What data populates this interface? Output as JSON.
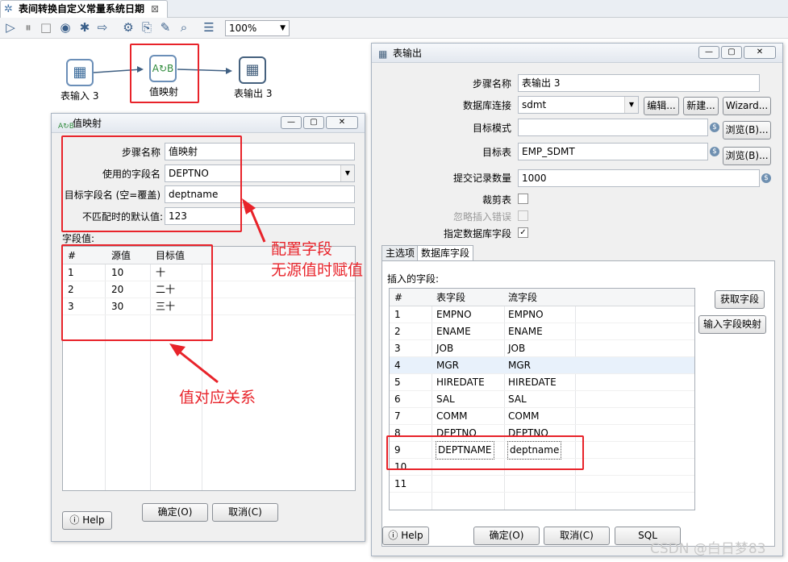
{
  "tab": {
    "title": "表间转换自定义常量系统日期"
  },
  "toolbar": {
    "zoom": "100%"
  },
  "canvas": {
    "nodes": [
      {
        "label": "表输入 3",
        "icon": "table-input-icon"
      },
      {
        "label": "值映射",
        "icon": "value-mapper-icon",
        "glyph": "A↻B"
      },
      {
        "label": "表输出 3",
        "icon": "table-output-icon"
      }
    ]
  },
  "mapper": {
    "title": "值映射",
    "step_name_label": "步骤名称",
    "step_name_value": "值映射",
    "field_label": "使用的字段名",
    "field_value": "DEPTNO",
    "target_label": "目标字段名 (空=覆盖)",
    "target_value": "deptname",
    "default_label": "不匹配时的默认值:",
    "default_value": "123",
    "fields_label": "字段值:",
    "columns": [
      "#",
      "源值",
      "目标值"
    ],
    "rows": [
      [
        "1",
        "10",
        "十"
      ],
      [
        "2",
        "20",
        "二十"
      ],
      [
        "3",
        "30",
        "三十"
      ]
    ],
    "help": "Help",
    "ok": "确定(O)",
    "cancel": "取消(C)"
  },
  "annotations": {
    "config_line1": "配置字段",
    "config_line2": "无源值时赋值",
    "mapping": "值对应关系"
  },
  "output": {
    "title": "表输出",
    "step_name_label": "步骤名称",
    "step_name_value": "表输出 3",
    "conn_label": "数据库连接",
    "conn_value": "sdmt",
    "edit_btn": "编辑...",
    "new_btn": "新建...",
    "wizard_btn": "Wizard...",
    "schema_label": "目标模式",
    "schema_value": "",
    "browse_btn": "浏览(B)...",
    "table_label": "目标表",
    "table_value": "EMP_SDMT",
    "commit_label": "提交记录数量",
    "commit_value": "1000",
    "truncate_label": "裁剪表",
    "ignore_label": "忽略插入错误",
    "specify_label": "指定数据库字段",
    "tabs": [
      "主选项",
      "数据库字段"
    ],
    "insert_label": "插入的字段:",
    "get_fields_btn": "获取字段",
    "map_btn": "输入字段映射",
    "columns": [
      "#",
      "表字段",
      "流字段"
    ],
    "rows": [
      [
        "1",
        "EMPNO",
        "EMPNO"
      ],
      [
        "2",
        "ENAME",
        "ENAME"
      ],
      [
        "3",
        "JOB",
        "JOB"
      ],
      [
        "4",
        "MGR",
        "MGR"
      ],
      [
        "5",
        "HIREDATE",
        "HIREDATE"
      ],
      [
        "6",
        "SAL",
        "SAL"
      ],
      [
        "7",
        "COMM",
        "COMM"
      ],
      [
        "8",
        "DEPTNO",
        "DEPTNO"
      ],
      [
        "9",
        "DEPTNAME",
        "deptname"
      ],
      [
        "10",
        "",
        ""
      ],
      [
        "11",
        "",
        ""
      ]
    ],
    "help": "Help",
    "ok": "确定(O)",
    "cancel": "取消(C)",
    "sql": "SQL"
  },
  "watermark": "CSDN @白日梦83"
}
